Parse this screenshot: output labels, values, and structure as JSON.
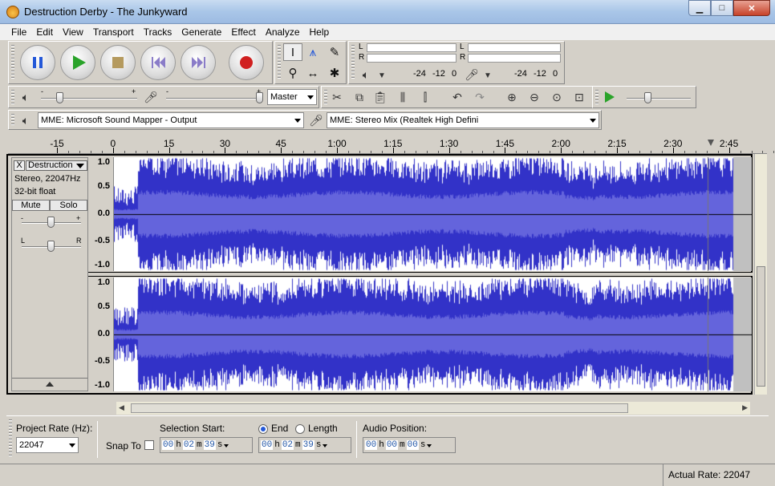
{
  "window": {
    "title": "Destruction Derby - The Junkyward"
  },
  "menu": [
    "File",
    "Edit",
    "View",
    "Transport",
    "Tracks",
    "Generate",
    "Effect",
    "Analyze",
    "Help"
  ],
  "meters": {
    "playback": {
      "left": "L",
      "right": "R",
      "scale": [
        "-24",
        "-12",
        "0"
      ]
    },
    "record": {
      "left": "L",
      "right": "R",
      "scale": [
        "-24",
        "-12",
        "0"
      ]
    }
  },
  "mixer": {
    "minus": "-",
    "plus": "+",
    "input_source": "Master"
  },
  "devices": {
    "output": "MME: Microsoft Sound Mapper - Output",
    "input": "MME: Stereo Mix (Realtek High Defini"
  },
  "timeline": {
    "ticks": [
      "-15",
      "0",
      "15",
      "30",
      "45",
      "1:00",
      "1:15",
      "1:30",
      "1:45",
      "2:00",
      "2:15",
      "2:30",
      "2:45"
    ]
  },
  "track": {
    "name": "Destruction",
    "close": "X",
    "format": "Stereo, 22047Hz",
    "bitdepth": "32-bit float",
    "mute": "Mute",
    "solo": "Solo",
    "gain_minus": "-",
    "gain_plus": "+",
    "pan_left": "L",
    "pan_right": "R",
    "scale": [
      "1.0",
      "0.5",
      "0.0",
      "-0.5",
      "-1.0"
    ]
  },
  "selection": {
    "project_rate_label": "Project Rate (Hz):",
    "project_rate": "22047",
    "snap_label": "Snap To",
    "selection_start_label": "Selection Start:",
    "end_label": "End",
    "length_label": "Length",
    "audio_position_label": "Audio Position:",
    "start": {
      "h": "00",
      "m": "02",
      "s": "39",
      "hu": "h",
      "mu": "m",
      "su": "s"
    },
    "end": {
      "h": "00",
      "m": "02",
      "s": "39",
      "hu": "h",
      "mu": "m",
      "su": "s"
    },
    "position": {
      "h": "00",
      "m": "00",
      "s": "00",
      "hu": "h",
      "mu": "m",
      "su": "s"
    }
  },
  "status": {
    "actual_rate": "Actual Rate: 22047"
  },
  "colors": {
    "wave": "#3232c8",
    "wave_rms": "#6464dc",
    "wave_bg": "#ffffff",
    "wave_unselected": "#c0c0c0"
  }
}
